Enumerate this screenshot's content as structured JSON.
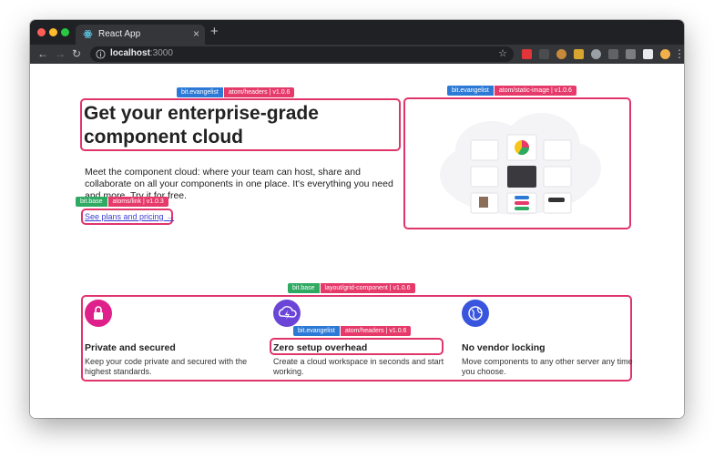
{
  "browser": {
    "tab_title": "React App",
    "tab_close": "×",
    "new_tab": "+",
    "url_host": "localhost",
    "url_port": ":3000",
    "back": "←",
    "forward": "→",
    "reload": "↻",
    "star": "☆",
    "menu": "⋮",
    "extensions": [
      "adblock-icon",
      "pen-icon",
      "cookie-icon",
      "note-icon",
      "chrome-icon",
      "circle-icon",
      "grid-icon",
      "g-icon",
      "avatar"
    ]
  },
  "hero": {
    "header_badge": {
      "scope": "bit.evangelist",
      "component": "atom/headers | v1.0.6"
    },
    "title": "Get your enterprise-grade component cloud",
    "text": "Meet the component cloud: where your team can host, share and collaborate on all your components in one place. It's everything you need and more. Try it for free.",
    "link_badge": {
      "scope": "bit.base",
      "component": "atoms/link | v1.0.3"
    },
    "link_text": "See plans and pricing",
    "link_arrow": "→"
  },
  "image_block": {
    "badge": {
      "scope": "bit.evangelist",
      "component": "atom/static-image | v1.0.6"
    }
  },
  "grid": {
    "badge": {
      "scope": "bit.base",
      "component": "layout/grid-component | v1.0.6"
    },
    "features": [
      {
        "title": "Private and secured",
        "text": "Keep your code private and secured with the highest standards.",
        "icon": "lock-icon",
        "color": "#e0208a"
      },
      {
        "title": "Zero setup overhead",
        "text": "Create a cloud workspace in seconds and start working.",
        "icon": "bolt-icon",
        "color": "#6a45d8",
        "badge": {
          "scope": "bit.evangelist",
          "component": "atom/headers | v1.0.6"
        }
      },
      {
        "title": "No vendor locking",
        "text": "Move components to any other server any time you choose.",
        "icon": "globe-icon",
        "color": "#3a55dd"
      }
    ]
  },
  "colors": {
    "accent": "#e0356b",
    "scope_blue": "#2d7ad6",
    "scope_green": "#2faa63",
    "component_pink": "#e63a6a"
  }
}
